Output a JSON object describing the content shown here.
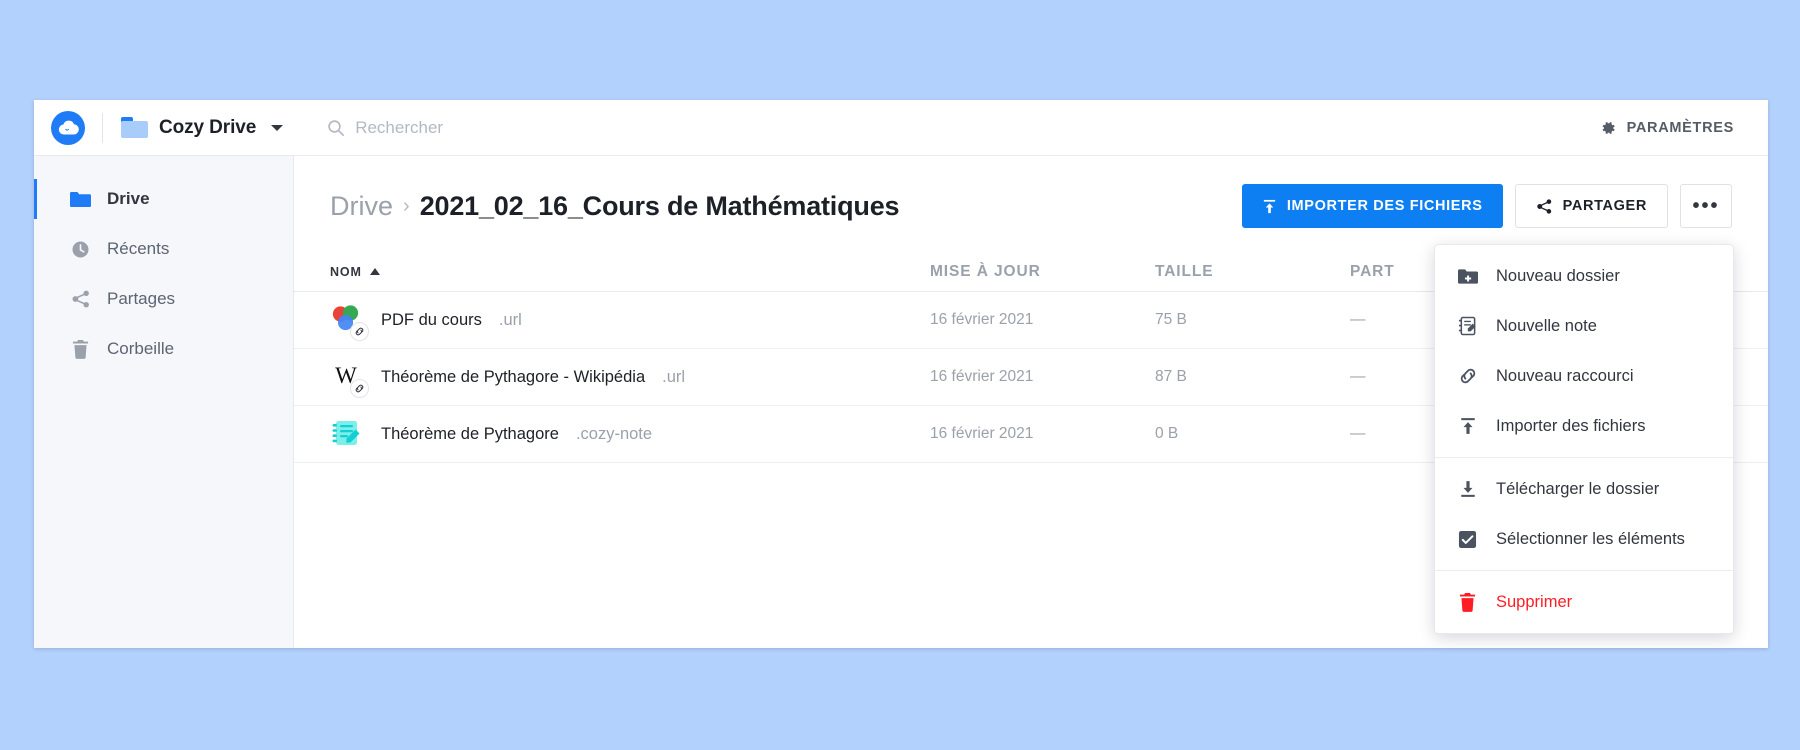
{
  "topbar": {
    "logo_icon": "cozy-cloud-logo",
    "folder_icon": "folder-icon",
    "app_name": "Cozy Drive",
    "app_chevron_icon": "chevron-down-icon",
    "search_icon": "search-icon",
    "search_placeholder": "Rechercher",
    "settings_icon": "gear-icon",
    "settings_label": "PARAMÈTRES"
  },
  "sidebar": {
    "items": [
      {
        "label": "Drive",
        "icon": "folder-icon",
        "active": true
      },
      {
        "label": "Récents",
        "icon": "clock-icon",
        "active": false
      },
      {
        "label": "Partages",
        "icon": "share-icon",
        "active": false
      },
      {
        "label": "Corbeille",
        "icon": "trash-icon",
        "active": false
      }
    ]
  },
  "breadcrumb": {
    "parent": "Drive",
    "separator": "›",
    "current": "2021_02_16_Cours de Mathématiques"
  },
  "actions": {
    "upload_icon": "upload-icon",
    "upload_label": "IMPORTER DES FICHIERS",
    "share_icon": "share-icon",
    "share_label": "PARTAGER",
    "more_label": "•••"
  },
  "table": {
    "columns": {
      "name": "NOM",
      "updated": "MISE À JOUR",
      "size": "TAILLE",
      "shared": "PART"
    },
    "sort_icon": "caret-up-icon",
    "rows": [
      {
        "icon": "chrome-circles-icon",
        "badge_icon": "link-icon",
        "name": "PDF du cours",
        "ext": ".url",
        "updated": "16 février 2021",
        "size": "75 B",
        "shared": "—"
      },
      {
        "icon": "wikipedia-w-icon",
        "badge_icon": "link-icon",
        "name": "Théorème de Pythagore - Wikipédia",
        "ext": ".url",
        "updated": "16 février 2021",
        "size": "87 B",
        "shared": "—"
      },
      {
        "icon": "cozy-note-icon",
        "badge_icon": "",
        "name": "Théorème de Pythagore",
        "ext": ".cozy-note",
        "updated": "16 février 2021",
        "size": "0 B",
        "shared": "—"
      }
    ]
  },
  "menu": {
    "items": [
      {
        "label": "Nouveau dossier",
        "icon": "folder-plus-icon",
        "danger": false
      },
      {
        "label": "Nouvelle note",
        "icon": "note-edit-icon",
        "danger": false
      },
      {
        "label": "Nouveau raccourci",
        "icon": "link-icon",
        "danger": false
      },
      {
        "label": "Importer des fichiers",
        "icon": "upload-icon",
        "danger": false
      },
      {
        "label": "Télécharger le dossier",
        "icon": "download-icon",
        "danger": false
      },
      {
        "label": "Sélectionner les éléments",
        "icon": "checkbox-icon",
        "danger": false
      },
      {
        "label": "Supprimer",
        "icon": "trash-icon",
        "danger": true
      }
    ]
  },
  "colors": {
    "page_background": "#b3d1fd",
    "accent_blue": "#0d7ff2",
    "danger_red": "#ff1d25",
    "note_cyan": "#5ce1e6"
  }
}
